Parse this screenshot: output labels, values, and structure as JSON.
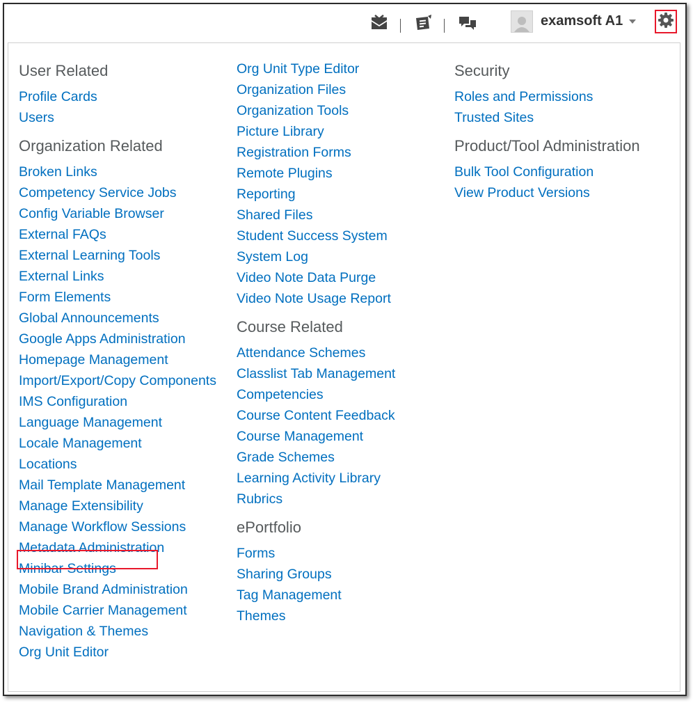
{
  "minibar": {
    "icons": [
      "mail-icon",
      "updates-icon",
      "subscriptions-icon"
    ],
    "username": "examsoft A1",
    "settings_icon": "gear-icon",
    "highlight_color": "#e8182b"
  },
  "admin_menu": {
    "link_color": "#006fbf",
    "heading_color": "#565a5c",
    "columns": [
      {
        "groups": [
          {
            "heading": "User Related",
            "items": [
              "Profile Cards",
              "Users"
            ]
          },
          {
            "heading": "Organization Related",
            "items": [
              "Broken Links",
              "Competency Service Jobs",
              "Config Variable Browser",
              "External FAQs",
              "External Learning Tools",
              "External Links",
              "Form Elements",
              "Global Announcements",
              "Google Apps Administration",
              "Homepage Management",
              "Import/Export/Copy Components",
              "IMS Configuration",
              "Language Management",
              "Locale Management",
              "Locations",
              "Mail Template Management",
              "Manage Extensibility",
              "Manage Workflow Sessions",
              "Metadata Administration",
              "Minibar Settings",
              "Mobile Brand Administration",
              "Mobile Carrier Management",
              "Navigation & Themes",
              "Org Unit Editor"
            ]
          }
        ]
      },
      {
        "groups": [
          {
            "heading": "",
            "items": [
              "Org Unit Type Editor",
              "Organization Files",
              "Organization Tools",
              "Picture Library",
              "Registration Forms",
              "Remote Plugins",
              "Reporting",
              "Shared Files",
              "Student Success System",
              "System Log",
              "Video Note Data Purge",
              "Video Note Usage Report"
            ]
          },
          {
            "heading": "Course Related",
            "items": [
              "Attendance Schemes",
              "Classlist Tab Management",
              "Competencies",
              "Course Content Feedback",
              "Course Management",
              "Grade Schemes",
              "Learning Activity Library",
              "Rubrics"
            ]
          },
          {
            "heading": "ePortfolio",
            "items": [
              "Forms",
              "Sharing Groups",
              "Tag Management",
              "Themes"
            ]
          }
        ]
      },
      {
        "groups": [
          {
            "heading": "Security",
            "items": [
              "Roles and Permissions",
              "Trusted Sites"
            ]
          },
          {
            "heading": "Product/Tool Administration",
            "items": [
              "Bulk Tool Configuration",
              "View Product Versions"
            ]
          }
        ]
      }
    ],
    "highlighted_item": "Manage Extensibility"
  }
}
